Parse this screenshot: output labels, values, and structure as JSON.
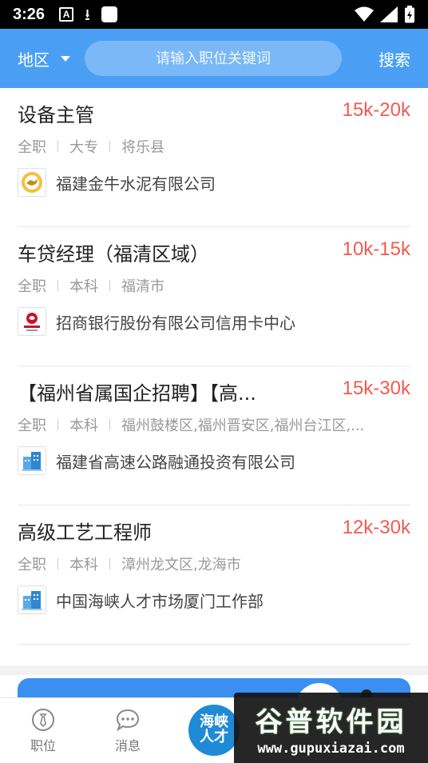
{
  "status_bar": {
    "time": "3:26",
    "a_label": "A"
  },
  "header": {
    "region_label": "地区",
    "search_placeholder": "请输入职位关键词",
    "search_button": "搜索"
  },
  "jobs": [
    {
      "title": "设备主管",
      "salary": "15k-20k",
      "type": "全职",
      "education": "大专",
      "location": "将乐县",
      "company": "福建金牛水泥有限公司",
      "logo": "golden-bull-logo"
    },
    {
      "title": "车贷经理（福清区域）",
      "salary": "10k-15k",
      "type": "全职",
      "education": "本科",
      "location": "福清市",
      "company": "招商银行股份有限公司信用卡中心",
      "logo": "cmb-logo"
    },
    {
      "title": "【福州省属国企招聘】【高...",
      "salary": "15k-30k",
      "type": "全职",
      "education": "本科",
      "location": "福州鼓楼区,福州晋安区,福州台江区,...",
      "company": "福建省高速公路融通投资有限公司",
      "logo": "job-building-logo"
    },
    {
      "title": "高级工艺工程师",
      "salary": "12k-30k",
      "type": "全职",
      "education": "本科",
      "location": "漳州龙文区,龙海市",
      "company": "中国海峡人才市场厦门工作部",
      "logo": "job-building-logo"
    }
  ],
  "bottom_nav": {
    "jobs_label": "职位",
    "messages_label": "消息",
    "center_line1": "海峡",
    "center_line2": "人才"
  },
  "watermark": {
    "brand": "谷普软件园",
    "url": "www.gupuxiazai.com"
  },
  "colors": {
    "header": "#4a9ff5",
    "salary": "#f25b4f"
  }
}
